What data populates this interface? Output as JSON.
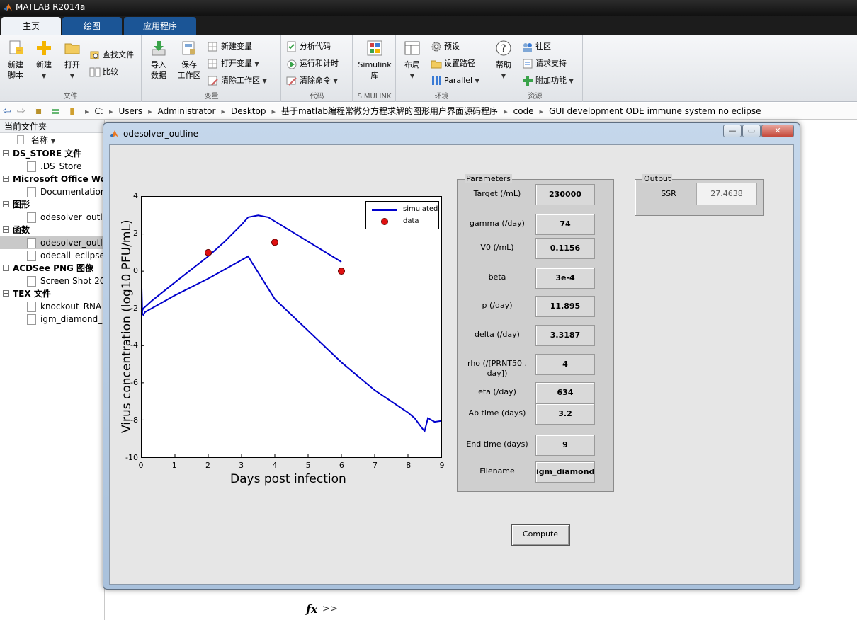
{
  "app": {
    "title": "MATLAB R2014a"
  },
  "tabs": [
    {
      "label": "主页",
      "active": true
    },
    {
      "label": "绘图",
      "active": false
    },
    {
      "label": "应用程序",
      "active": false
    }
  ],
  "ribbon": {
    "file": {
      "section_label": "文件",
      "new_script": "新建\n脚本",
      "new": "新建",
      "open": "打开",
      "find_files": "查找文件",
      "compare": "比较"
    },
    "variable": {
      "section_label": "变量",
      "import_data": "导入\n数据",
      "save_workspace": "保存\n工作区",
      "new_variable": "新建变量",
      "open_variable": "打开变量",
      "clear_workspace": "清除工作区"
    },
    "code": {
      "section_label": "代码",
      "analyze_code": "分析代码",
      "run_and_time": "运行和计时",
      "clear_commands": "清除命令"
    },
    "simulink": {
      "section_label": "SIMULINK",
      "library": "Simulink\n库"
    },
    "environment": {
      "section_label": "环境",
      "layout": "布局",
      "preferences": "预设",
      "set_path": "设置路径",
      "parallel": "Parallel"
    },
    "resources": {
      "section_label": "资源",
      "help": "帮助",
      "community": "社区",
      "request_support": "请求支持",
      "add_ons": "附加功能"
    }
  },
  "address": {
    "crumbs": [
      "C:",
      "Users",
      "Administrator",
      "Desktop",
      "基于matlab编程常微分方程求解的图形用户界面源码程序",
      "code",
      "GUI development ODE immune system no eclipse"
    ]
  },
  "current_folder": {
    "title": "当前文件夹",
    "column_name": "名称",
    "groups": [
      {
        "label": "DS_STORE 文件",
        "items": [
          ".DS_Store"
        ]
      },
      {
        "label": "Microsoft Office Wo",
        "items": [
          "Documentation"
        ]
      },
      {
        "label": "图形",
        "items": [
          "odesolver_outli"
        ]
      },
      {
        "label": "函数",
        "items": [
          "odesolver_outli",
          "odecall_eclipse"
        ]
      },
      {
        "label": "ACDSee PNG 图像",
        "items": [
          "Screen Shot 20"
        ]
      },
      {
        "label": "TEX 文件",
        "items": [
          "knockout_RNA_",
          "igm_diamond_n"
        ]
      }
    ]
  },
  "command": {
    "prompt": "fx",
    "chevrons": ">>"
  },
  "figure": {
    "title": "odesolver_outline",
    "window_buttons": {
      "minimize": "—",
      "maximize": "▭",
      "close": "✕"
    },
    "axes": {
      "xlabel": "Days post infection",
      "ylabel": "Virus concentration (log10 PFU/mL)",
      "xticks": [
        "0",
        "1",
        "2",
        "3",
        "4",
        "5",
        "6",
        "7",
        "8",
        "9"
      ],
      "yticks": [
        "4",
        "2",
        "0",
        "-2",
        "-4",
        "-6",
        "-8",
        "-10"
      ]
    },
    "legend": {
      "simulated": "simulated",
      "data": "data"
    },
    "parameters": {
      "title": "Parameters",
      "rows": [
        {
          "label": "Target (/mL)",
          "value": "230000"
        },
        {
          "label": "gamma (/day)",
          "value": "74"
        },
        {
          "label": "V0 (/mL)",
          "value": "0.1156"
        },
        {
          "label": "beta",
          "value": "3e-4"
        },
        {
          "label": "p (/day)",
          "value": "11.895"
        },
        {
          "label": "delta (/day)",
          "value": "3.3187"
        },
        {
          "label": "rho (/[PRNT50 .\nday])",
          "value": "4"
        },
        {
          "label": "eta (/day)",
          "value": "634"
        },
        {
          "label": "Ab time (days)",
          "value": "3.2"
        },
        {
          "label": "End time (days)",
          "value": "9"
        },
        {
          "label": "Filename",
          "value": "igm_diamond_"
        }
      ]
    },
    "output": {
      "title": "Output",
      "ssr_label": "SSR",
      "ssr_value": "27.4638"
    },
    "compute_button": "Compute"
  },
  "chart_data": {
    "type": "line",
    "xlabel": "Days post infection",
    "ylabel": "",
    "xlim": [
      0,
      9
    ],
    "ylim": [
      -10,
      4
    ],
    "series": [
      {
        "name": "simulated",
        "color": "#0000cc",
        "x": [
          0,
          0.05,
          0.3,
          1,
          2,
          2.5,
          3,
          3.2,
          3.5,
          3.8,
          6.0
        ],
        "y": [
          -2.2,
          -2.0,
          -1.6,
          -0.6,
          0.8,
          1.6,
          2.5,
          2.9,
          3.0,
          2.9,
          0.5
        ]
      },
      {
        "name": "",
        "color": "#0000cc",
        "x": [
          0,
          0.02,
          0.05,
          0.1,
          1,
          2,
          3,
          3.2,
          3.3,
          4,
          5,
          6,
          7,
          8,
          8.2,
          8.45,
          8.5,
          8.6,
          8.8,
          9
        ],
        "y": [
          -0.9,
          -2.3,
          -2.35,
          -2.2,
          -1.3,
          -0.4,
          0.6,
          0.8,
          0.5,
          -1.5,
          -3.2,
          -4.9,
          -6.4,
          -7.6,
          -7.9,
          -8.5,
          -8.6,
          -7.9,
          -8.1,
          -8.05
        ]
      },
      {
        "name": "data",
        "color": "#e01010",
        "x": [
          2,
          4,
          6
        ],
        "y": [
          1.0,
          1.55,
          0
        ]
      }
    ]
  }
}
